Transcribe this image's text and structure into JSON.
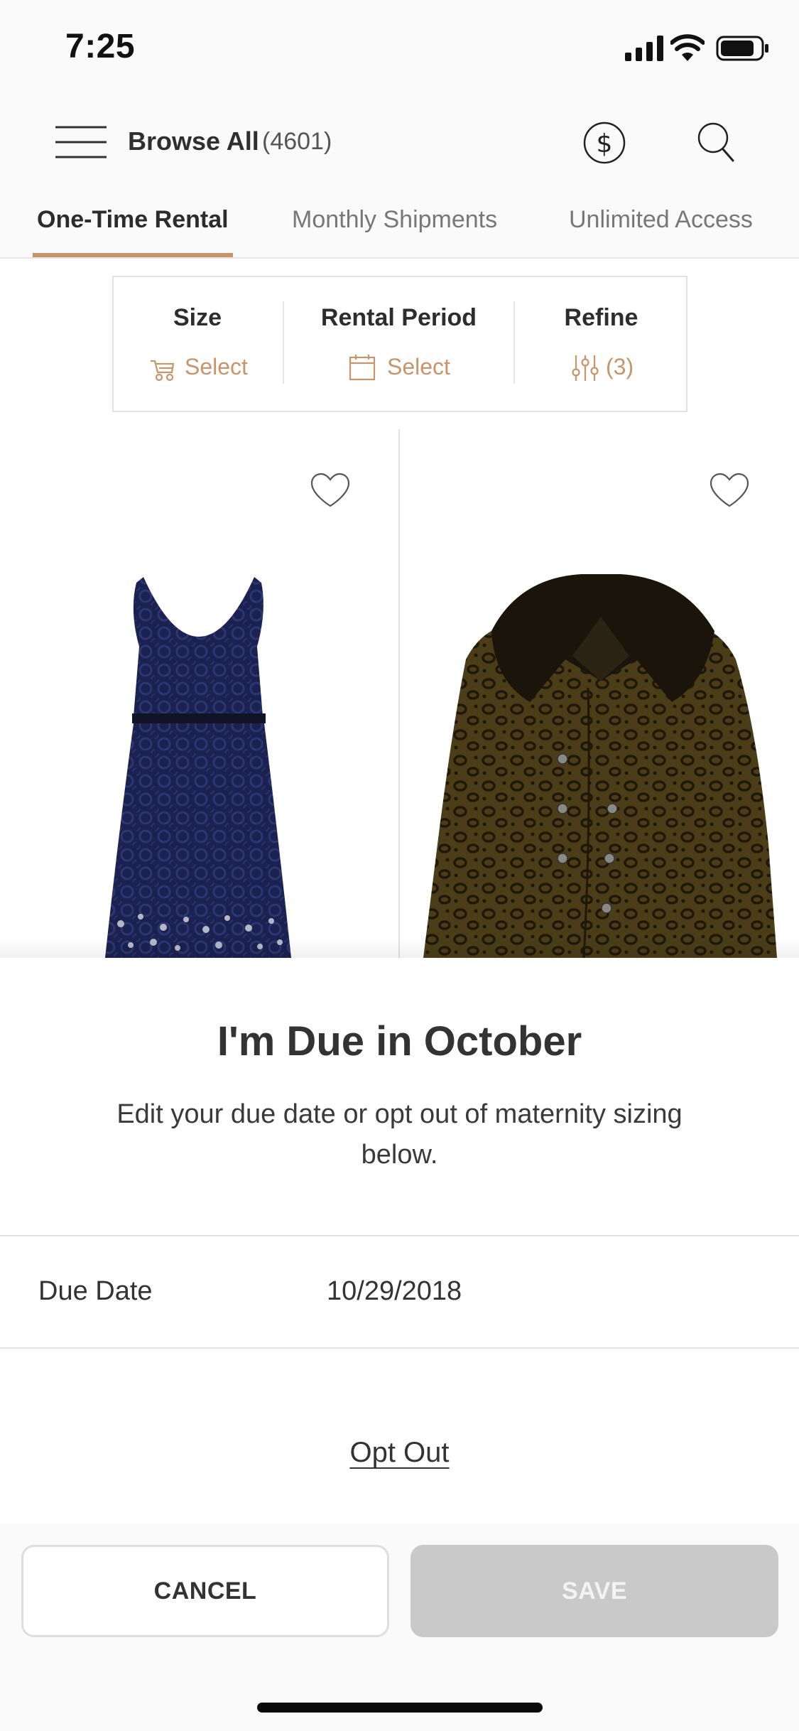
{
  "status_bar": {
    "time": "7:25"
  },
  "header": {
    "menu_icon": "hamburger-menu-icon",
    "title": "Browse All",
    "count": "(4601)",
    "dollar_icon": "dollar-circle-icon",
    "search_icon": "search-icon"
  },
  "tabs": [
    {
      "label": "One-Time Rental",
      "active": true
    },
    {
      "label": "Monthly Shipments",
      "active": false
    },
    {
      "label": "Unlimited Access",
      "active": false
    }
  ],
  "filters": [
    {
      "label": "Size",
      "value": "Select",
      "icon": "stroller-icon"
    },
    {
      "label": "Rental Period",
      "value": "Select",
      "icon": "calendar-icon"
    },
    {
      "label": "Refine",
      "value": "(3)",
      "icon": "sliders-icon"
    }
  ],
  "products": [
    {
      "name": "navy-lace-dress",
      "favorite_icon": "heart-outline-icon"
    },
    {
      "name": "leopard-faux-fur-coat",
      "favorite_icon": "heart-outline-icon"
    }
  ],
  "sheet": {
    "title": "I'm Due in October",
    "subtitle": "Edit your due date or opt out of maternity sizing below.",
    "due_date_label": "Due Date",
    "due_date_value": "10/29/2018",
    "opt_out_label": "Opt Out",
    "cancel_label": "CANCEL",
    "save_label": "SAVE"
  },
  "colors": {
    "accent": "#c8956b",
    "save_disabled": "#c9c9c9"
  }
}
